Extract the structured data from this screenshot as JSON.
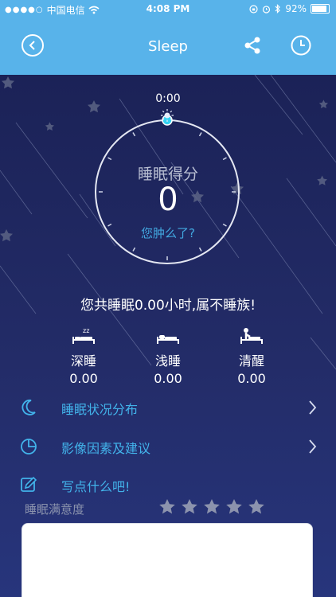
{
  "status_bar": {
    "carrier": "中国电信",
    "time": "4:08 PM",
    "battery": "92%",
    "battery_level": 0.92
  },
  "nav": {
    "title": "Sleep",
    "back_icon": "chevron-left-circle-icon",
    "share_icon": "share-icon",
    "history_icon": "clock-icon"
  },
  "ring": {
    "time_label": "0:00",
    "score_label": "睡眠得分",
    "score": "0",
    "link": "您肿么了?",
    "progress": 0
  },
  "summary": "您共睡眠0.00小时,属不睡族!",
  "stats": [
    {
      "label": "深睡",
      "value": "0.00",
      "icon": "deep-sleep-icon"
    },
    {
      "label": "浅睡",
      "value": "0.00",
      "icon": "light-sleep-icon"
    },
    {
      "label": "清醒",
      "value": "0.00",
      "icon": "awake-icon"
    }
  ],
  "menu": [
    {
      "label": "睡眠状况分布",
      "icon": "moon-icon"
    },
    {
      "label": "影像因素及建议",
      "icon": "pie-chart-icon"
    },
    {
      "label": "写点什么吧!",
      "icon": "edit-icon"
    }
  ],
  "rating": {
    "label": "睡眠满意度",
    "max": 5,
    "value": 0
  },
  "note": {
    "value": ""
  },
  "colors": {
    "header": "#58b3ea",
    "accent": "#42b3ea",
    "background": "#1c2353"
  }
}
